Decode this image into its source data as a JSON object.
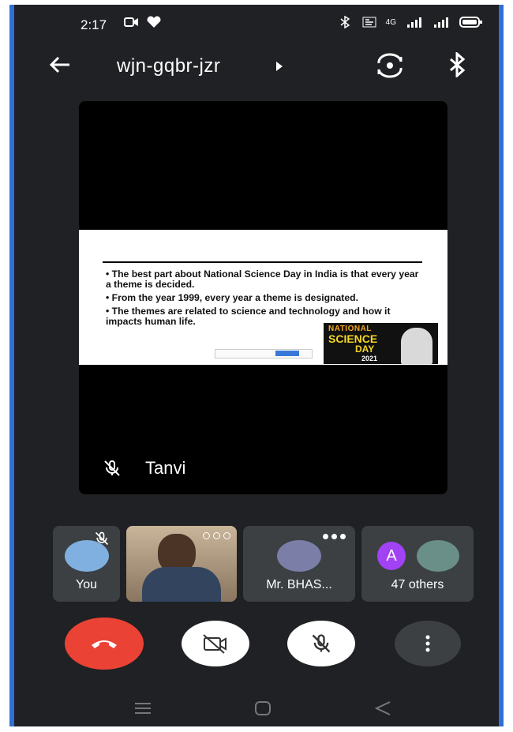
{
  "status_bar": {
    "time": "2:17",
    "network": "4G"
  },
  "meeting": {
    "code": "wjn-gqbr-jzr"
  },
  "presenter": {
    "name": "Tanvi",
    "slide": {
      "bullets": [
        "The best part about National Science Day in India is that every year a theme is decided.",
        "From the year 1999, every year a theme is designated.",
        "The themes are related to science and technology and how it impacts human life."
      ],
      "poster": {
        "line1": "NATIONAL",
        "line2": "SCIENCE",
        "line3": "DAY",
        "year": "2021"
      }
    }
  },
  "participants": [
    {
      "label": "You"
    },
    {
      "label": ""
    },
    {
      "label": "Mr. BHAS..."
    },
    {
      "label": "47 others",
      "avatar_letter": "A"
    }
  ],
  "colors": {
    "background": "#202124",
    "tile": "#3c4043",
    "end_call": "#ea4335",
    "control": "#ffffff",
    "avatar_a": "#a142f4"
  }
}
